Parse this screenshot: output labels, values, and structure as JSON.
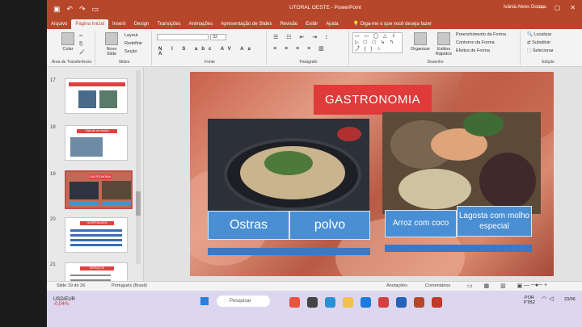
{
  "window": {
    "title": "UTORAL OESTE  -  PowerPoint",
    "user": "Ivânia Alves Gomes",
    "qat": [
      "save-icon",
      "undo-icon",
      "redo-icon",
      "present-icon"
    ]
  },
  "tabs": [
    "Arquivo",
    "Página Inicial",
    "Inserir",
    "Design",
    "Transições",
    "Animações",
    "Apresentação de Slides",
    "Revisão",
    "Exibir",
    "Ajuda"
  ],
  "tell_me": "Diga-me o que você deseja fazer",
  "ribbon": {
    "clipboard": {
      "paste": "Colar",
      "label": "Área de Transferência"
    },
    "slides": {
      "new_slide": "Novo Slide",
      "layout": "Layout",
      "reset": "Redefinir",
      "section": "Seção",
      "label": "Slides"
    },
    "font": {
      "label": "Fonte",
      "size": "32",
      "format_buttons": "N I S abc AV Aa A"
    },
    "paragraph": {
      "label": "Parágrafo"
    },
    "drawing": {
      "arrange": "Organizar",
      "quick_styles": "Estilos Rápidos",
      "fill": "Preenchimento da Forma",
      "outline": "Contorno da Forma",
      "effects": "Efeitos de Forma",
      "label": "Desenho",
      "shapes": "▭ ▭ ◯ △ ⇩ ▷ ⬡ ⬠ ↳ ↰ ⤴ { } ☆"
    },
    "editing": {
      "find": "Localizar",
      "replace": "Substituir",
      "select": "Selecionar",
      "label": "Edição"
    }
  },
  "thumbnails": [
    {
      "num": "17"
    },
    {
      "num": "18",
      "title": "Vista de um trecho"
    },
    {
      "num": "19",
      "title": "GASTRONOMIA",
      "selected": true
    },
    {
      "num": "20",
      "title": "HOSPEDAGEM"
    },
    {
      "num": "21",
      "title": "SERVIÇOS"
    }
  ],
  "slide": {
    "title": "GASTRONOMIA",
    "captions": [
      "Ostras",
      "polvo",
      "Arroz com coco",
      "Lagosta com molho especial"
    ]
  },
  "statusbar": {
    "slide_count": "Slide 19 de 26",
    "language": "Português (Brasil)",
    "notes": "Anotações",
    "comments": "Comentários"
  },
  "taskbar": {
    "weather": "USD/EUR",
    "weather_change": "-0,04%",
    "search_placeholder": "Pesquisar",
    "lang": "POR",
    "lang_sub": "PTB2",
    "date": "23/06"
  },
  "colors": {
    "accent": "#b7472a",
    "slide_title_bg": "#e03a3a",
    "caption_bg": "#4a8fd4",
    "strip": "#3a78c8"
  }
}
